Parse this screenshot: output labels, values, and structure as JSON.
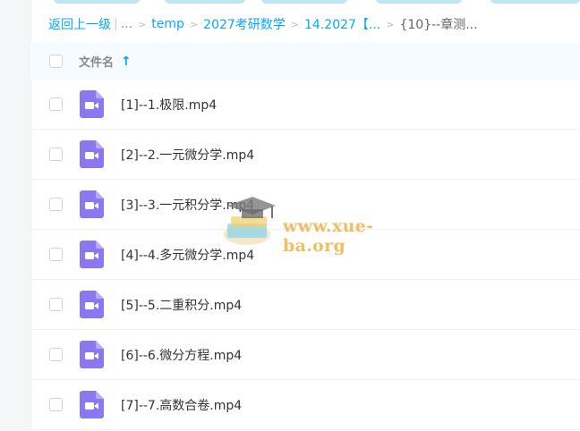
{
  "breadcrumb": {
    "back": "返回上一级",
    "more": "...",
    "items": [
      "temp",
      "2027考研数学",
      "14.2027【..."
    ],
    "current": "{10}--章测..."
  },
  "header": {
    "name_label": "文件名",
    "sort_icon": "arrow-up-icon"
  },
  "file_icon": "video-file-icon",
  "files": [
    "[1]--1.极限.mp4",
    "[2]--2.一元微分学.mp4",
    "[3]--3.一元积分学.mp4",
    "[4]--4.多元微分学.mp4",
    "[5]--5.二重积分.mp4",
    "[6]--6.微分方程.mp4",
    "[7]--7.高数合卷.mp4"
  ],
  "watermark": {
    "text": "www.xue-ba.org"
  },
  "colors": {
    "accent": "#06a7ff",
    "video_icon": "#8b78f0",
    "header_bg": "#f5fbff",
    "watermark": "#f2b24a"
  }
}
